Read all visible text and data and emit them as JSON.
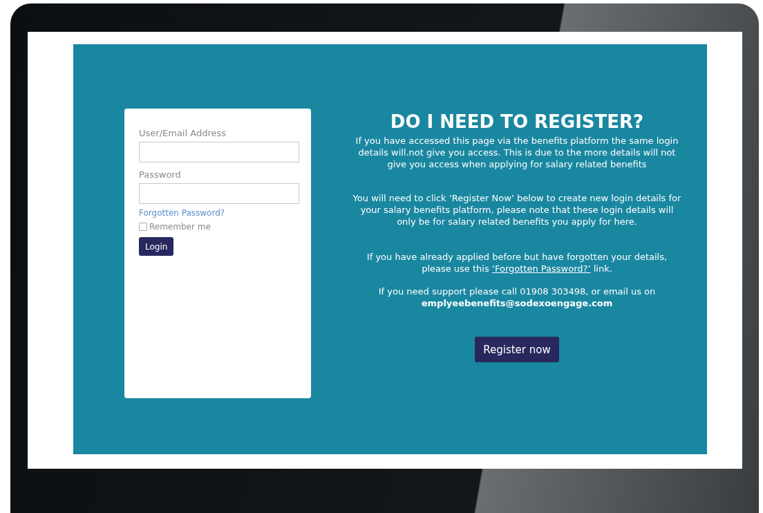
{
  "login_form": {
    "username_label": "User/Email Address",
    "password_label": "Password",
    "forgot_link": "Forgotten Password?",
    "remember_me": {
      "label": "Remember me",
      "checked": false
    },
    "login_button": "Login"
  },
  "register_info": {
    "title": "DO I NEED TO REGISTER?",
    "paragraphs": [
      {
        "kind": "plain",
        "text": "If you have accessed this page via the benefits platform the same login details will.not give you access. This is due to the more details will not give you access when applying for salary related benefits"
      },
      {
        "kind": "plain",
        "text": "You will need to click ‘Register Now’ below to create new login details for your salary benefits platform, please note that these login details will only be for salary related benefits you apply for here."
      },
      {
        "kind": "link",
        "before": "If you have already applied before but have forgotten your details, please use this ",
        "link": "‘Forgotten Password?’",
        "after": " link."
      },
      {
        "kind": "plain",
        "text": "If you need support please call 01908 303498, or email us on **emplyeebenefits@sodexoengage.com**"
      }
    ],
    "register_button": "Register now"
  }
}
